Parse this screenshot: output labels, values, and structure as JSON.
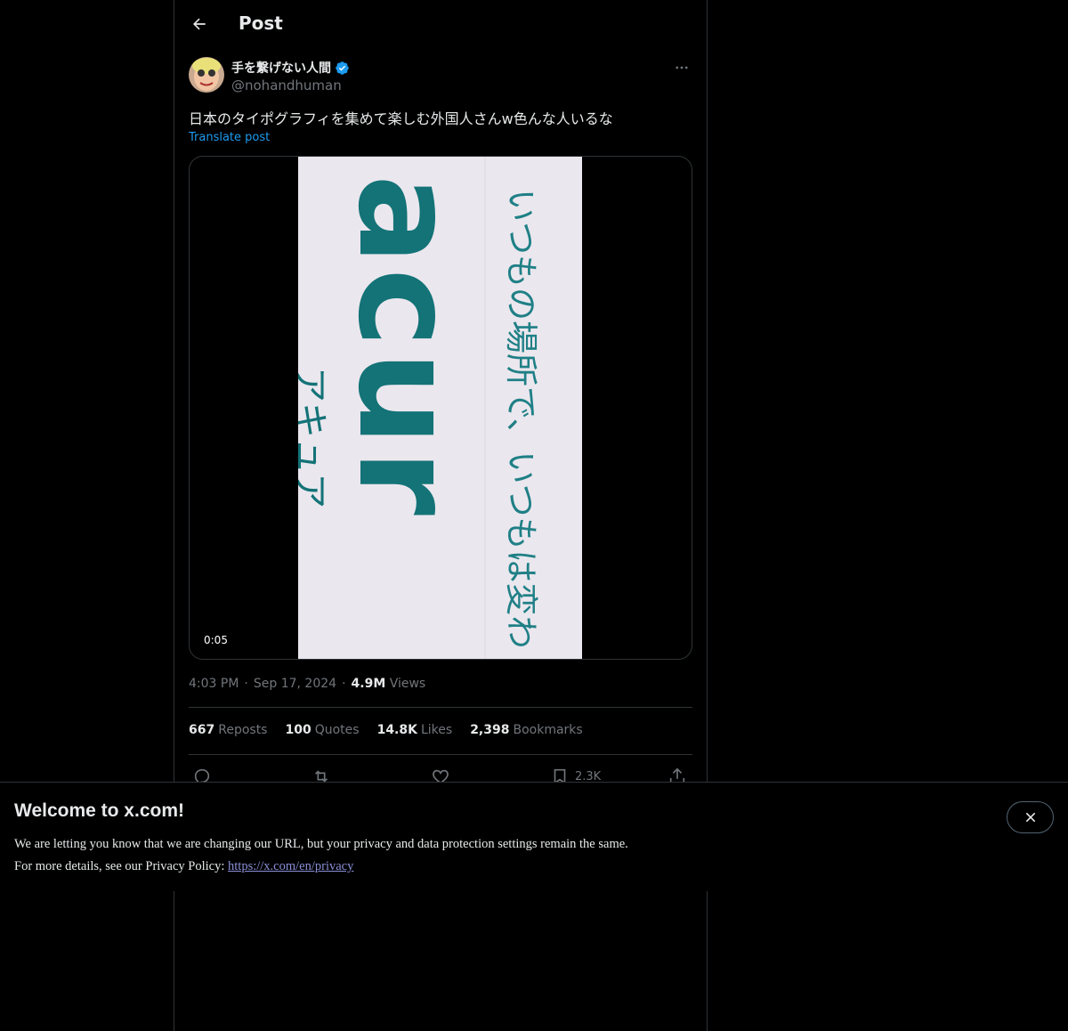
{
  "header": {
    "title": "Post"
  },
  "author": {
    "name": "手を繋げない人間",
    "handle": "@nohandhuman"
  },
  "post": {
    "text": "日本のタイポグラフィを集めて楽しむ外国人さんw色んな人いるな",
    "translate_label": "Translate post",
    "video_duration": "0:05",
    "video_overlay": {
      "brand_text": "acur",
      "katakana": "アキュア",
      "slogan": "いつもの場所で、いつもは変わ"
    }
  },
  "meta": {
    "time": "4:03 PM",
    "dot": "·",
    "date": "Sep 17, 2024",
    "views_count": "4.9M",
    "views_label": "Views"
  },
  "stats": [
    {
      "num": "667",
      "label": "Reposts"
    },
    {
      "num": "100",
      "label": "Quotes"
    },
    {
      "num": "14.8K",
      "label": "Likes"
    },
    {
      "num": "2,398",
      "label": "Bookmarks"
    }
  ],
  "actions": {
    "bookmark_count": "2.3K"
  },
  "banner": {
    "title": "Welcome to x.com!",
    "line1": "We are letting you know that we are changing our URL, but your privacy and data protection settings remain the same.",
    "line2_prefix": "For more details, see our Privacy Policy:",
    "link": "https://x.com/en/privacy"
  },
  "colors": {
    "accent": "#1d9bf0",
    "background": "#000000",
    "divider": "#2f3336",
    "muted": "#71767b",
    "teal_brand": "#137377"
  },
  "icons": [
    "back-arrow-icon",
    "verified-icon",
    "more-icon",
    "reply-icon",
    "repost-icon",
    "like-icon",
    "bookmark-icon",
    "share-icon",
    "close-icon"
  ]
}
